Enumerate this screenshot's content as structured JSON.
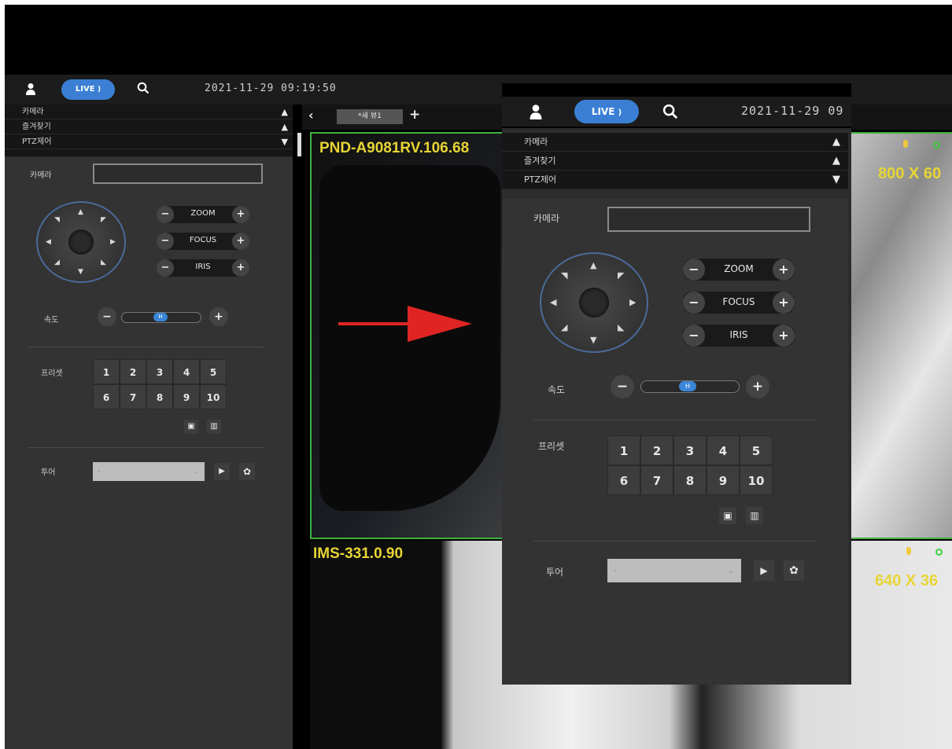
{
  "topbar": {
    "live_label": "LIVE",
    "datetime": "2021-11-29 09:19:50"
  },
  "left_panel": {
    "sections": [
      {
        "label": "카메라",
        "chevron": "^"
      },
      {
        "label": "즐겨찾기",
        "chevron": "^"
      },
      {
        "label": "PTZ제어",
        "chevron": "v"
      }
    ],
    "ptz": {
      "camera_label": "카메라",
      "camera_value": "",
      "zoom_label": "ZOOM",
      "focus_label": "FOCUS",
      "iris_label": "IRIS",
      "speed_label": "속도",
      "speed_knob_text": "H",
      "preset_label": "프리셋",
      "presets": [
        "1",
        "2",
        "3",
        "4",
        "5",
        "6",
        "7",
        "8",
        "9",
        "10"
      ],
      "tour_label": "투어",
      "tour_value": "-"
    }
  },
  "tabs": {
    "tab_label": "*새 뷰1"
  },
  "videos": [
    {
      "camera": "PND-A9081RV.106.68",
      "resolution": "800 X 60"
    },
    {
      "camera": "IMS-331.0.90",
      "resolution": "640 X 36"
    }
  ],
  "zoomed_overlay": {
    "live_label": "LIVE",
    "datetime": "2021-11-29 09",
    "sections": [
      {
        "label": "카메라"
      },
      {
        "label": "즐겨찾기"
      },
      {
        "label": "PTZ제어"
      }
    ],
    "camera_label": "카메라",
    "zoom_label": "ZOOM",
    "focus_label": "FOCUS",
    "iris_label": "IRIS",
    "speed_label": "속도",
    "speed_knob_text": "H",
    "preset_label": "프리셋",
    "presets": [
      "1",
      "2",
      "3",
      "4",
      "5",
      "6",
      "7",
      "8",
      "9",
      "10"
    ],
    "tour_label": "투어",
    "tour_value": "-"
  },
  "colors": {
    "accent_live": "#3a7fd4",
    "overlay_text": "#e8d534",
    "selected_border": "#3cb43c",
    "arrow": "#e02424"
  }
}
